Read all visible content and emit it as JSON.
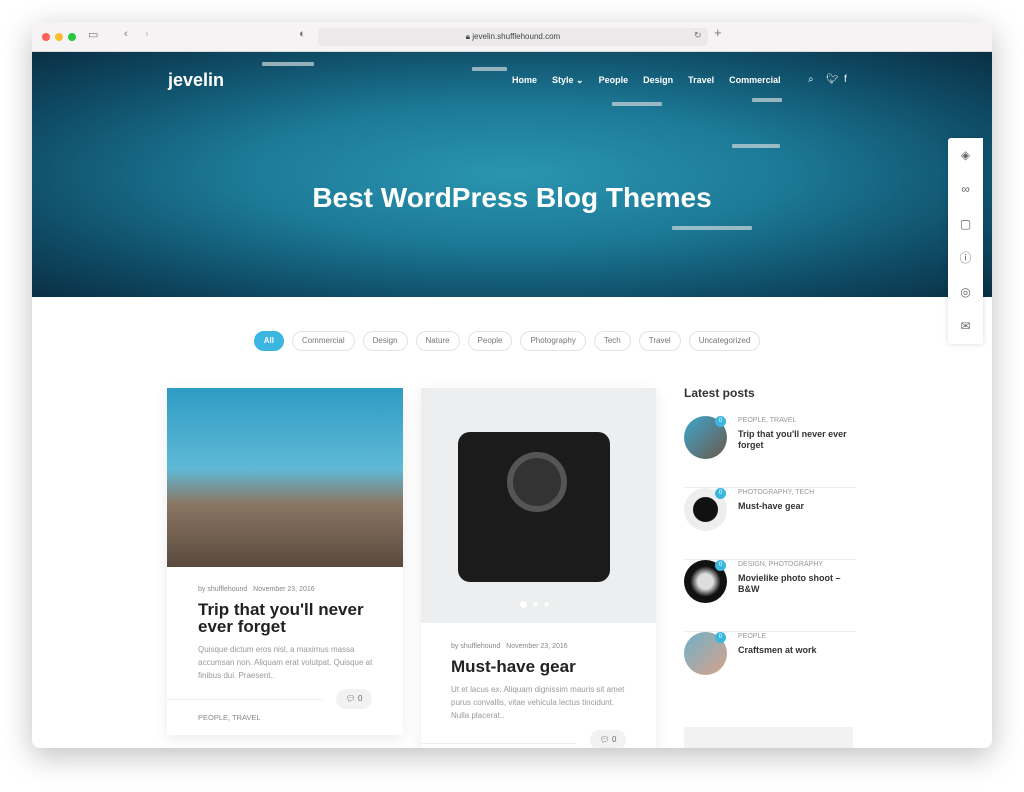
{
  "browser": {
    "url": "jevelin.shufflehound.com"
  },
  "site": {
    "logo": "jevelin",
    "nav": [
      "Home",
      "Style",
      "People",
      "Design",
      "Travel",
      "Commercial"
    ],
    "hero_title": "Best WordPress Blog Themes"
  },
  "filters": [
    "All",
    "Commercial",
    "Design",
    "Nature",
    "People",
    "Photography",
    "Tech",
    "Travel",
    "Uncategorized"
  ],
  "posts": [
    {
      "author": "by shufflehound",
      "date": "November 23, 2016",
      "title": "Trip that you'll never ever forget",
      "excerpt": "Quisque dictum eros nisl, a maximus massa accumsan non. Aliquam erat volutpat. Quisque at finibus dui. Praesent..",
      "comments": "0",
      "categories": "PEOPLE, TRAVEL"
    },
    {
      "author": "by shufflehound",
      "date": "November 23, 2016",
      "title": "Must-have gear",
      "excerpt": "Ut et lacus ex. Aliquam dignissim mauris sit amet purus convallis, vitae vehicula lectus tincidunt. Nulla placerat..",
      "comments": "0"
    }
  ],
  "sidebar": {
    "title": "Latest posts",
    "items": [
      {
        "cats": "PEOPLE, TRAVEL",
        "title": "Trip that you'll never ever forget",
        "count": "0"
      },
      {
        "cats": "PHOTOGRAPHY, TECH",
        "title": "Must-have gear",
        "count": "0"
      },
      {
        "cats": "DESIGN, PHOTOGRAPHY",
        "title": "Movielike photo shoot – B&W",
        "count": "0"
      },
      {
        "cats": "PEOPLE",
        "title": "Craftsmen at work",
        "count": "0"
      }
    ]
  },
  "colors": {
    "accent": "#3ab6e0"
  }
}
